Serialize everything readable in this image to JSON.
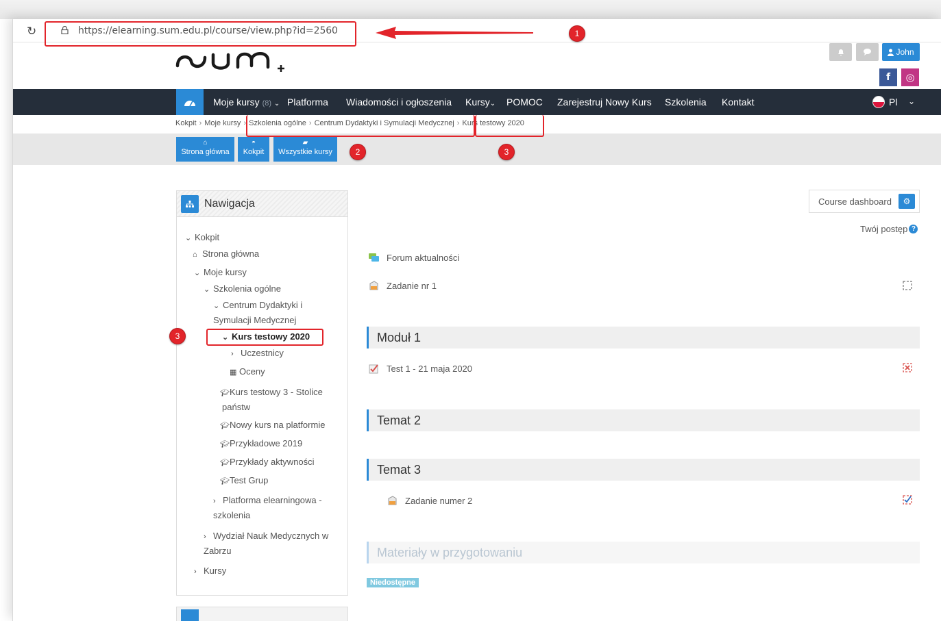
{
  "browser": {
    "url": "https://elearning.sum.edu.pl/course/view.php?id=2560"
  },
  "header": {
    "user_label": "John",
    "facebook": "f",
    "instagram": "◎"
  },
  "nav": {
    "items": [
      {
        "label": "Moje kursy",
        "badge": "(8)"
      },
      {
        "label": "Platforma"
      },
      {
        "label": "Wiadomości i ogłoszenia"
      },
      {
        "label": "Kursy"
      },
      {
        "label": "POMOC"
      },
      {
        "label": "Zarejestruj Nowy Kurs"
      },
      {
        "label": "Szkolenia"
      },
      {
        "label": "Kontakt"
      }
    ],
    "lang": "Pl"
  },
  "breadcrumb": [
    "Kokpit",
    "Moje kursy",
    "Szkolenia ogólne",
    "Centrum Dydaktyki i Symulacji Medycznej",
    "Kurs testowy 2020"
  ],
  "quick_links": [
    "Strona główna",
    "Kokpit",
    "Wszystkie kursy"
  ],
  "annotations": [
    "1",
    "2",
    "3",
    "3"
  ],
  "sidebar": {
    "title": "Nawigacja",
    "items": [
      {
        "label": "Kokpit"
      },
      {
        "label": "Strona główna"
      },
      {
        "label": "Moje kursy"
      },
      {
        "label": "Szkolenia ogólne"
      },
      {
        "label": "Centrum Dydaktyki i",
        "label2": "Symulacji Medycznej"
      },
      {
        "label": "Kurs testowy 2020"
      },
      {
        "label": "Uczestnicy"
      },
      {
        "label": "Oceny"
      },
      {
        "label": "Kurs testowy 3 - Stolice",
        "label2": "państw"
      },
      {
        "label": "Nowy kurs na platformie"
      },
      {
        "label": "Przykładowe 2019"
      },
      {
        "label": "Przykłady aktywności"
      },
      {
        "label": "Test Grup"
      },
      {
        "label": "Platforma elearningowa -",
        "label2": "szkolenia"
      },
      {
        "label": "Wydział Nauk Medycznych w",
        "label2": "Zabrzu"
      },
      {
        "label": "Kursy"
      }
    ]
  },
  "main": {
    "dashboard_label": "Course dashboard",
    "progress_label": "Twój postęp",
    "activities": [
      {
        "label": "Forum aktualności"
      },
      {
        "label": "Zadanie nr 1"
      },
      {
        "label": "Test 1 - 21 maja 2020"
      },
      {
        "label": "Zadanie numer 2"
      }
    ],
    "sections": [
      "Moduł 1",
      "Temat 2",
      "Temat 3",
      "Materiały w przygotowaniu"
    ],
    "unavailable_label": "Niedostępne"
  },
  "colors": {
    "accent": "#2b8ad6",
    "navbar": "#252e3a",
    "annotation": "#e2242a"
  }
}
